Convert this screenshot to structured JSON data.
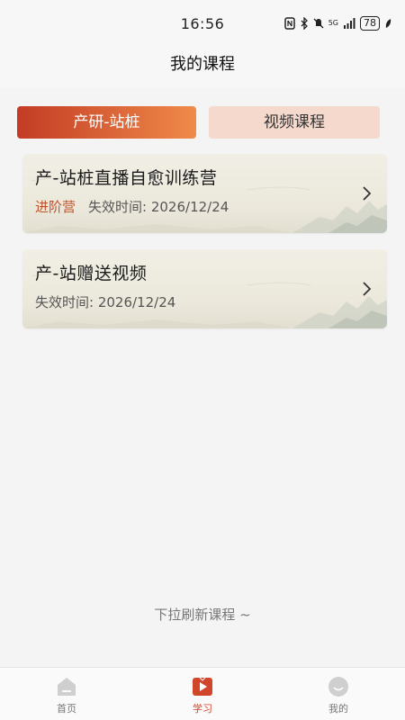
{
  "status_bar": {
    "time": "16:56",
    "network": "5G",
    "battery": "78",
    "icons": [
      "nfc-icon",
      "bluetooth-icon",
      "mute-icon",
      "signal-icon",
      "battery-icon",
      "leaf-icon"
    ]
  },
  "header": {
    "title": "我的课程"
  },
  "tabs": [
    {
      "label": "产研-站桩",
      "active": true
    },
    {
      "label": "视频课程",
      "active": false
    }
  ],
  "courses": [
    {
      "title": "产-站桩直播自愈训练营",
      "tag": "进阶营",
      "expiry": "失效时间: 2026/12/24"
    },
    {
      "title": "产-站赠送视频",
      "tag": "",
      "expiry": "失效时间: 2026/12/24"
    }
  ],
  "refresh_hint": "下拉刷新课程 ~",
  "bottom_nav": [
    {
      "label": "首页",
      "icon": "home-icon",
      "active": false
    },
    {
      "label": "学习",
      "icon": "study-play-icon",
      "active": true
    },
    {
      "label": "我的",
      "icon": "profile-smile-icon",
      "active": false
    }
  ],
  "colors": {
    "accent": "#d1452a",
    "tab_gradient_start": "#c23c24",
    "tab_gradient_end": "#f08a4a",
    "tab_inactive_bg": "#f6d9cd",
    "tag_color": "#c0522a"
  }
}
